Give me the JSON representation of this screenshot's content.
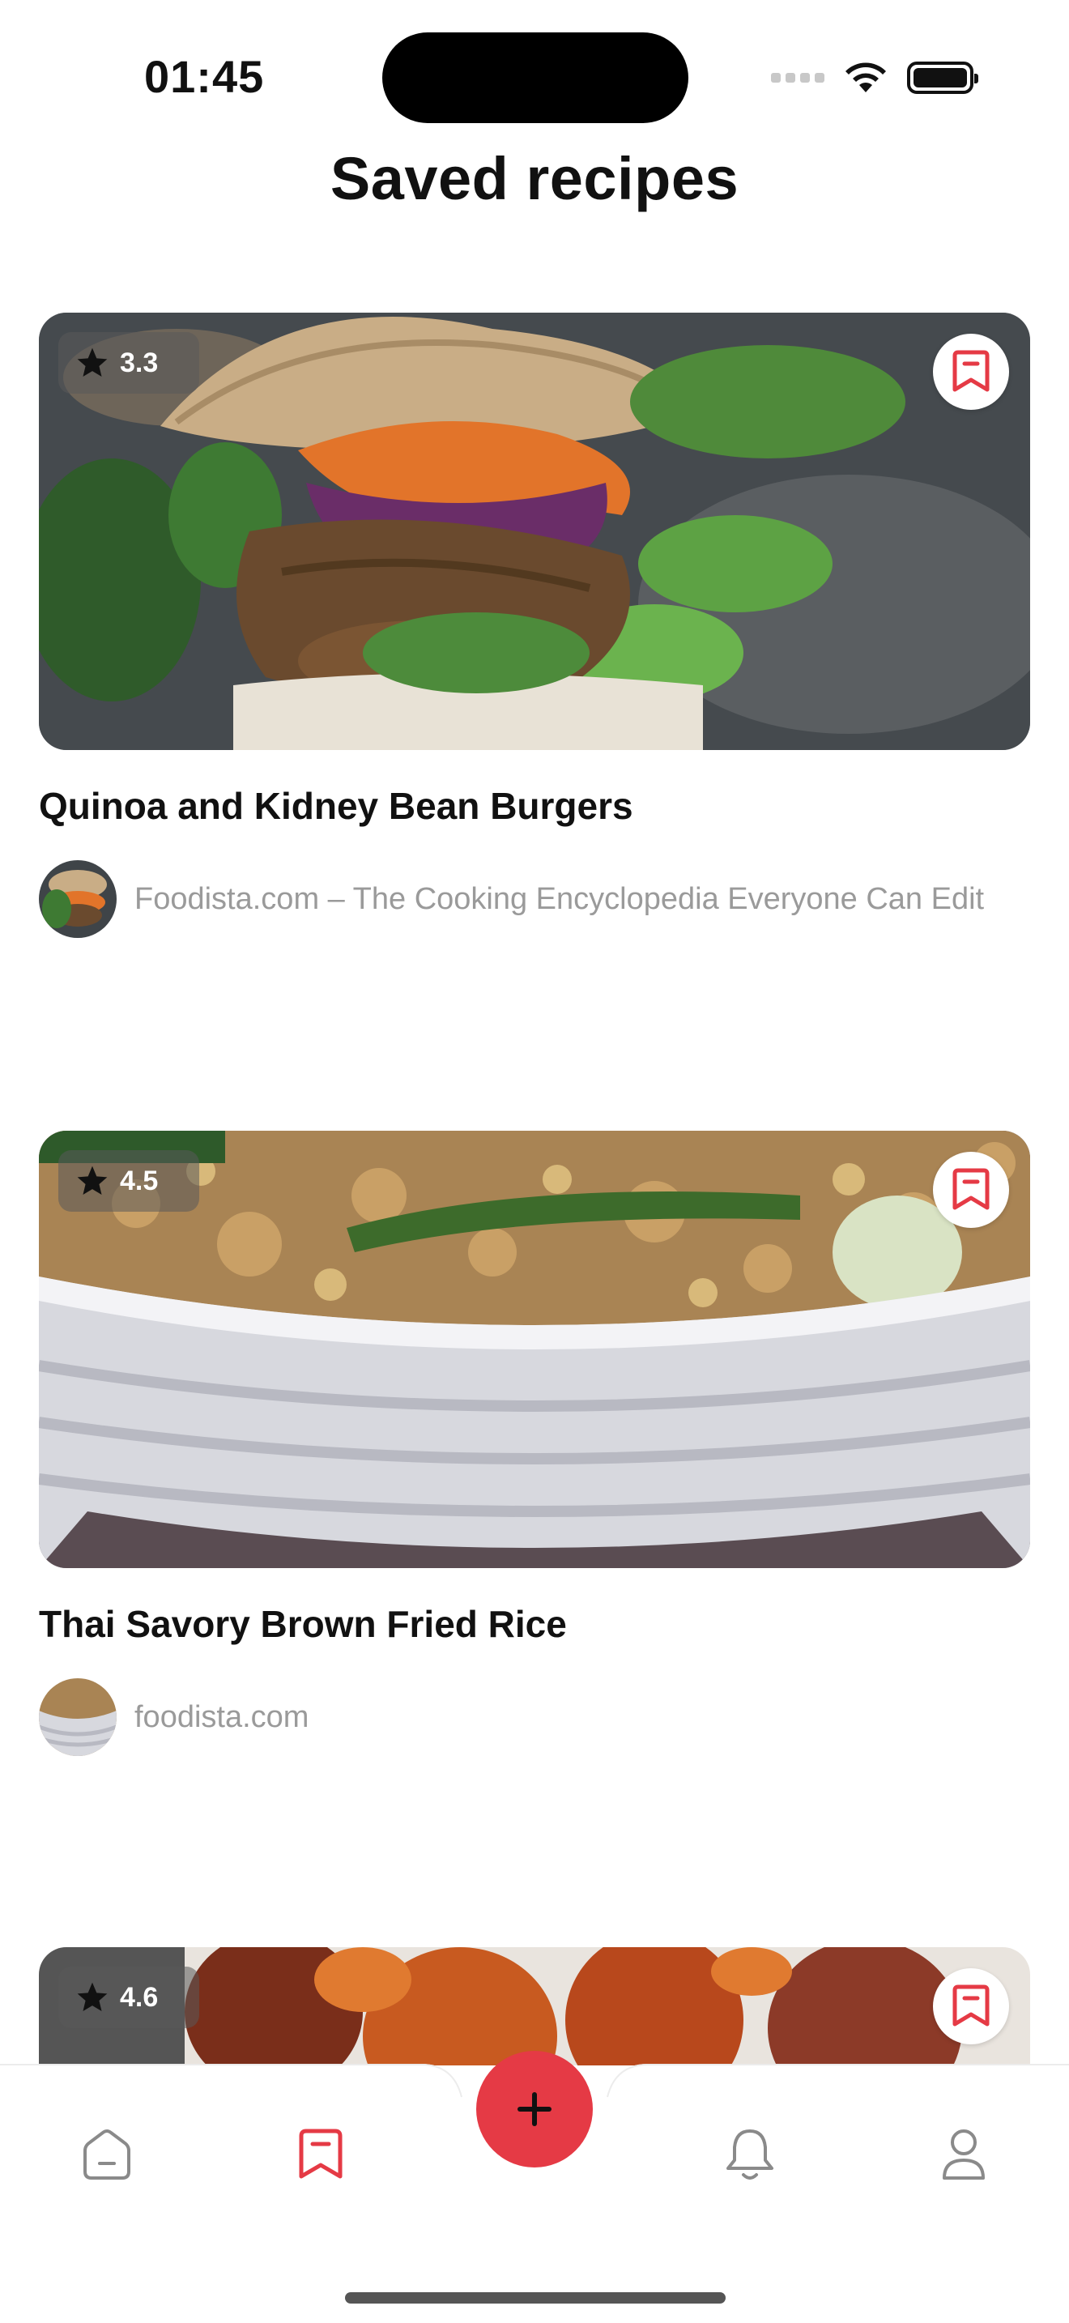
{
  "status": {
    "time": "01:45"
  },
  "page": {
    "title": "Saved recipes"
  },
  "recipes": [
    {
      "title": "Quinoa and Kidney Bean Burgers",
      "rating": "3.3",
      "source": "Foodista.com – The Cooking Encyclopedia Everyone Can Edit",
      "bookmarked": true
    },
    {
      "title": "Thai Savory Brown Fried Rice",
      "rating": "4.5",
      "source": "foodista.com",
      "bookmarked": true
    },
    {
      "title": "",
      "rating": "4.6",
      "source": "",
      "bookmarked": true
    }
  ],
  "nav": {
    "items": [
      "home-icon",
      "bookmark-icon",
      "add-icon",
      "bell-icon",
      "profile-icon"
    ],
    "active": "bookmark-icon"
  },
  "colors": {
    "accent": "#e53a45",
    "text": "#111111",
    "muted": "#9a9a9a"
  }
}
